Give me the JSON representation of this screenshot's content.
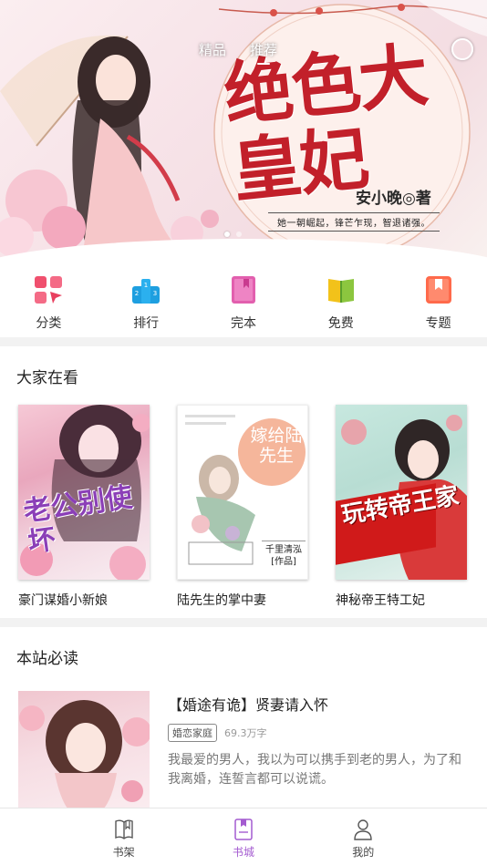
{
  "banner": {
    "tabs": [
      {
        "label": "精品"
      },
      {
        "label": "推荐"
      }
    ],
    "active_tab": 1,
    "title": "绝色大皇妃",
    "author": "安小晚◎著",
    "tagline": "她一朝崛起，锋芒乍现，智退诸强。",
    "slide_count": 2,
    "active_slide": 0
  },
  "quick_nav": [
    {
      "label": "分类",
      "icon": "category-icon",
      "color": "#f0506e"
    },
    {
      "label": "排行",
      "icon": "ranking-icon",
      "color": "#1e9fe0"
    },
    {
      "label": "完本",
      "icon": "completed-book-icon",
      "color": "#e25fae"
    },
    {
      "label": "免费",
      "icon": "free-book-icon",
      "color": "#9ccf2c"
    },
    {
      "label": "专题",
      "icon": "topic-icon",
      "color": "#ff6a4b"
    }
  ],
  "popular": {
    "title": "大家在看",
    "books": [
      {
        "name": "豪门谋婚小新娘",
        "cover_text": "老公别使坏"
      },
      {
        "name": "陆先生的掌中妻",
        "cover_text": "嫁给陆先生",
        "cover_author": "千里清泓[作品]"
      },
      {
        "name": "神秘帝王特工妃",
        "cover_text": "玩转帝王家"
      }
    ]
  },
  "must_read": {
    "title": "本站必读",
    "items": [
      {
        "title": "【婚途有诡】贤妻请入怀",
        "tag": "婚恋家庭",
        "words": "69.3万字",
        "desc": "我最爱的男人，我以为可以携手到老的男人，为了和我离婚，连誓言都可以说谎。"
      }
    ]
  },
  "bottom_nav": [
    {
      "label": "书架",
      "icon": "bookshelf-icon"
    },
    {
      "label": "书城",
      "icon": "bookstore-icon"
    },
    {
      "label": "我的",
      "icon": "profile-icon"
    }
  ],
  "bottom_nav_active": 1,
  "colors": {
    "accent": "#a45bd0",
    "title_red": "#c2202a"
  }
}
